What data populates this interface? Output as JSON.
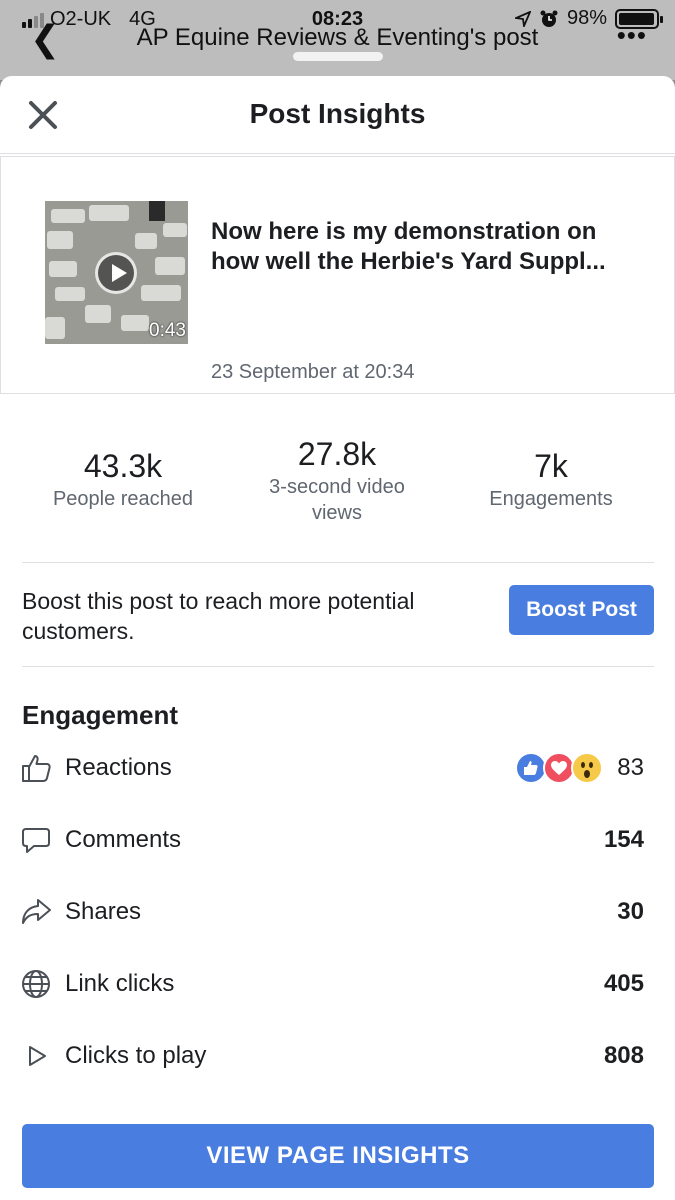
{
  "status_bar": {
    "carrier": "O2-UK",
    "network": "4G",
    "time": "08:23",
    "battery": "98%",
    "battery_level": 0.98
  },
  "background_page": {
    "title": "AP Equine Reviews & Eventing's post"
  },
  "header": {
    "title": "Post Insights"
  },
  "post": {
    "text_line_1": "Now here is my demonstration on",
    "text_line_2": "how well the Herbie's Yard Suppl...",
    "date": "23 September at 20:34",
    "duration": "0:43"
  },
  "stats": [
    {
      "value": "43.3k",
      "label": "People reached"
    },
    {
      "value": "27.8k",
      "label_line_1": "3-second video",
      "label_line_2": "views"
    },
    {
      "value": "7k",
      "label": "Engagements"
    }
  ],
  "boost": {
    "text": "Boost this post to reach more potential customers.",
    "button": "Boost Post"
  },
  "engagement": {
    "heading": "Engagement",
    "items": [
      {
        "label": "Reactions",
        "value": "83",
        "icon": "thumbs-up-icon"
      },
      {
        "label": "Comments",
        "value": "154",
        "icon": "comment-icon"
      },
      {
        "label": "Shares",
        "value": "30",
        "icon": "share-icon"
      },
      {
        "label": "Link clicks",
        "value": "405",
        "icon": "globe-icon"
      },
      {
        "label": "Clicks to play",
        "value": "808",
        "icon": "play-icon"
      }
    ],
    "reaction_icons": [
      "like-reaction-icon",
      "love-reaction-icon",
      "wow-reaction-icon"
    ]
  },
  "cta": {
    "label": "VIEW PAGE INSIGHTS"
  },
  "colors": {
    "accent": "#4a7de0",
    "like": "#4a7de0",
    "love": "#ef4f5f",
    "wow": "#f7c948"
  }
}
